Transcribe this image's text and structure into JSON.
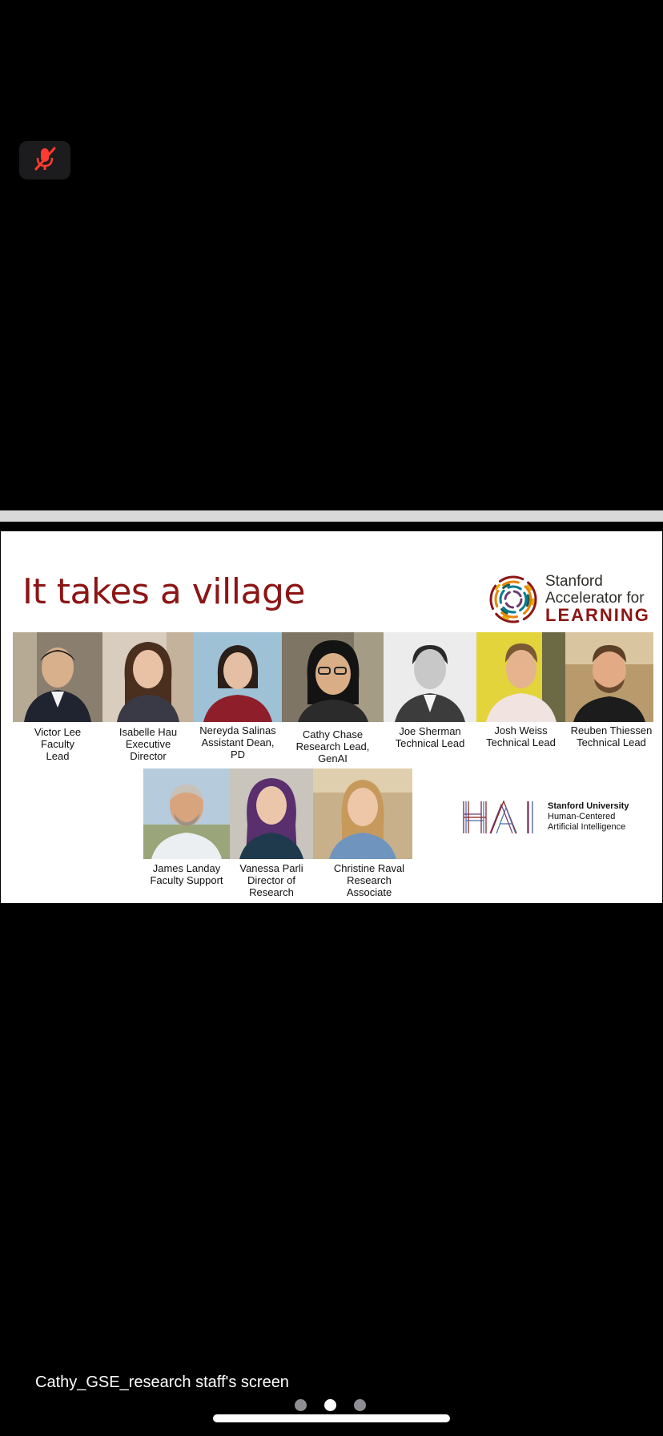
{
  "toolbar": {
    "mute_icon": "microphone-muted-icon",
    "mute_color": "#ff3b30"
  },
  "slide": {
    "title": "It takes a village",
    "title_color": "#8c1515",
    "sal_logo": {
      "line1": "Stanford",
      "line2": "Accelerator for",
      "line3": "LEARNING"
    },
    "hai_logo": {
      "mark": "HAI",
      "line1": "Stanford University",
      "line2": "Human-Centered",
      "line3": "Artificial Intelligence"
    },
    "people": [
      {
        "name": "Victor Lee",
        "role_lines": [
          "Faculty",
          "Lead"
        ]
      },
      {
        "name": "Isabelle Hau",
        "role_lines": [
          "Executive",
          "Director"
        ]
      },
      {
        "name": "Nereyda Salinas",
        "role_lines": [
          "Assistant Dean,",
          "PD"
        ]
      },
      {
        "name": "Cathy Chase",
        "role_lines": [
          "Research Lead,",
          "GenAI"
        ]
      },
      {
        "name": "Joe Sherman",
        "role_lines": [
          "Technical Lead"
        ]
      },
      {
        "name": "Josh Weiss",
        "role_lines": [
          "Technical Lead"
        ]
      },
      {
        "name": "Reuben Thiessen",
        "role_lines": [
          "Technical Lead"
        ]
      },
      {
        "name": "James Landay",
        "role_lines": [
          "Faculty Support"
        ]
      },
      {
        "name": "Vanessa Parli",
        "role_lines": [
          "Director of",
          "Research"
        ]
      },
      {
        "name": "Christine Raval",
        "role_lines": [
          "Research",
          "Associate"
        ]
      }
    ]
  },
  "footer": {
    "screen_label": "Cathy_GSE_research staff's screen",
    "page_dots": 3,
    "active_dot": 2
  }
}
